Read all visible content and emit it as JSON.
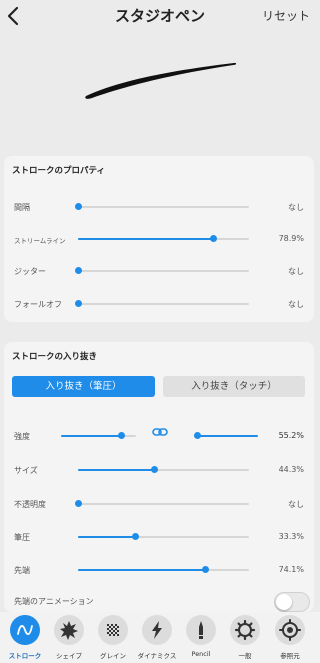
{
  "header": {
    "title": "スタジオペン",
    "reset_label": "リセット"
  },
  "properties": {
    "title": "ストロークのプロパティ",
    "rows": [
      {
        "label": "間隔",
        "value": "なし",
        "level": 0
      },
      {
        "label": "ストリームライン",
        "value": "78.9%",
        "level": 0.789
      },
      {
        "label": "ジッター",
        "value": "なし",
        "level": 0
      },
      {
        "label": "フォールオフ",
        "value": "なし",
        "level": 0
      }
    ]
  },
  "taper": {
    "title": "ストロークの入り抜き",
    "tabs": [
      "入り抜き（筆圧）",
      "入り抜き（タッチ）"
    ],
    "rows": [
      {
        "label": "強度",
        "value": "55.2%",
        "level_left": 0.95,
        "level_right": 0.0
      },
      {
        "label": "サイズ",
        "value": "44.3%",
        "level": 0.443
      },
      {
        "label": "不透明度",
        "value": "なし",
        "level": 0
      },
      {
        "label": "筆圧",
        "value": "33.3%",
        "level": 0.333
      },
      {
        "label": "先端",
        "value": "74.1%",
        "level": 0.741
      },
      {
        "label": "先端のアニメーション",
        "toggle": false
      }
    ]
  },
  "tabbar": [
    {
      "label": "ストローク",
      "icon": "stroke-icon",
      "active": true
    },
    {
      "label": "シェイプ",
      "icon": "shape-icon"
    },
    {
      "label": "グレイン",
      "icon": "grain-icon"
    },
    {
      "label": "ダイナミクス",
      "icon": "dynamics-icon"
    },
    {
      "label": "Pencil",
      "icon": "pencil-icon"
    },
    {
      "label": "一般",
      "icon": "general-icon"
    },
    {
      "label": "参照元",
      "icon": "source-icon"
    }
  ],
  "colors": {
    "accent": "#1e8ce8"
  }
}
